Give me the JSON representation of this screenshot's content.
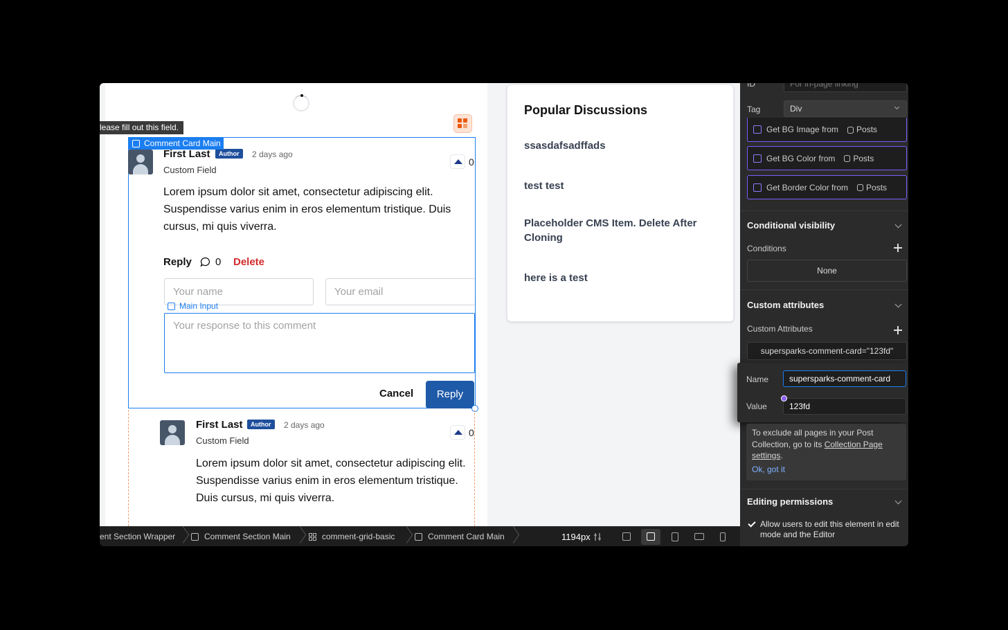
{
  "canvas": {
    "validation_tooltip": "lease fill out this field.",
    "selected_element_label": "Comment Card Main",
    "main_input_label": "Main Input",
    "comment1": {
      "name": "First Last",
      "badge": "Author",
      "time": "2 days ago",
      "field": "Custom Field",
      "body": "Lorem ipsum dolor sit amet, consectetur adipiscing elit. Suspendisse varius enim in eros elementum tristique. Duis cursus, mi quis viverra.",
      "vote_count": "0",
      "reply_label": "Reply",
      "reply_count": "0",
      "delete_label": "Delete"
    },
    "reply_form": {
      "name_placeholder": "Your name",
      "email_placeholder": "Your email",
      "response_placeholder": "Your response to this comment",
      "cancel_label": "Cancel",
      "submit_label": "Reply"
    },
    "comment2": {
      "name": "First Last",
      "badge": "Author",
      "time": "2 days ago",
      "field": "Custom Field",
      "body": "Lorem ipsum dolor sit amet, consectetur adipiscing elit. Suspendisse varius enim in eros elementum tristique. Duis cursus, mi quis viverra.",
      "vote_count": "0"
    },
    "popular": {
      "title": "Popular Discussions",
      "items": [
        "ssasdafsadffads",
        "test test",
        "Placeholder CMS Item. Delete After Cloning",
        "here is a test"
      ]
    }
  },
  "breadcrumbs": [
    "ent Section Wrapper",
    "Comment Section Main",
    "comment-grid-basic",
    "Comment Card Main"
  ],
  "viewport": {
    "width_label": "1194px"
  },
  "panel": {
    "id_label": "ID",
    "id_placeholder": "For in-page linking",
    "tag_label": "Tag",
    "tag_value": "Div",
    "bindings": [
      {
        "label": "Get BG Image from",
        "source": "Posts"
      },
      {
        "label": "Get BG Color from",
        "source": "Posts"
      },
      {
        "label": "Get Border Color from",
        "source": "Posts"
      }
    ],
    "conditional_visibility": {
      "title": "Conditional visibility",
      "conditions_label": "Conditions",
      "value": "None"
    },
    "custom_attributes": {
      "title": "Custom attributes",
      "label": "Custom Attributes",
      "existing": "supersparks-comment-card=\"123fd\"",
      "name_label": "Name",
      "name_value": "supersparks-comment-card",
      "value_label": "Value",
      "value_value": "123fd"
    },
    "info": {
      "text_before": "To exclude all pages in your Post Collection, go to its ",
      "link": "Collection Page settings",
      "text_after": ".",
      "ok": "Ok, got it"
    },
    "editing_permissions": {
      "title": "Editing permissions",
      "checkbox_label": "Allow users to edit this element in edit mode and the Editor",
      "checked": true
    }
  },
  "colors": {
    "accent": "#1b7ef0",
    "reply_button": "#1e5aa8",
    "delete": "#d42a2a",
    "binding_border": "#7c5cff",
    "cms_icon": "#ea580c"
  }
}
